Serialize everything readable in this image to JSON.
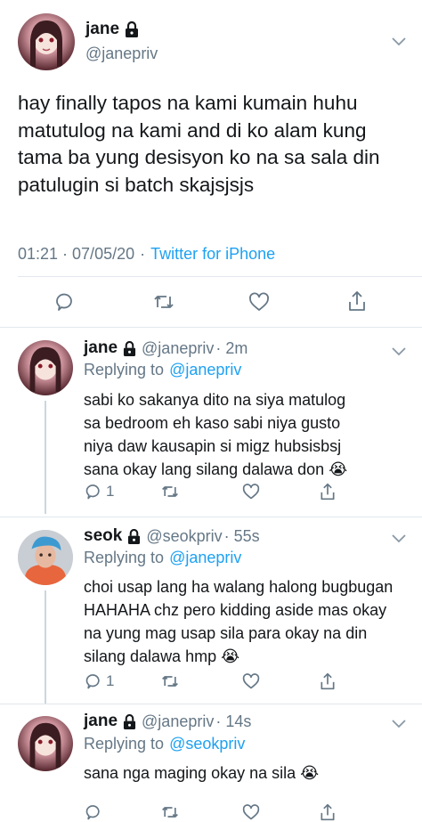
{
  "main": {
    "user_name": "jane",
    "handle": "@janepriv",
    "text": "hay finally tapos na kami kumain huhu matutulog na kami and di ko alam kung tama ba yung desisyon ko na sa sala din patulugin si batch skajsjsjs",
    "time": "01:21 · 07/05/20",
    "sep": "·",
    "source": "Twitter for iPhone"
  },
  "replies": [
    {
      "user_name": "jane",
      "handle": "@janepriv",
      "age": "· 2m",
      "replying_label": "Replying to",
      "replying_to": "@janepriv",
      "text": "sabi ko sakanya dito na siya matulog sa bedroom eh kaso sabi niya gusto niya daw kausapin si migz hubsisbsj sana okay lang silang dalawa don 😭",
      "reply_count": "1"
    },
    {
      "user_name": "seok",
      "handle": "@seokpriv",
      "age": "· 55s",
      "replying_label": "Replying to",
      "replying_to": "@janepriv",
      "text": "choi usap lang ha walang halong bugbugan HAHAHA chz pero kidding aside mas okay na yung mag usap sila para okay na din silang dalawa hmp 😭",
      "reply_count": "1"
    },
    {
      "user_name": "jane",
      "handle": "@janepriv",
      "age": "· 14s",
      "replying_label": "Replying to",
      "replying_to": "@seokpriv",
      "text": "sana nga maging okay na sila 😭",
      "reply_count": ""
    }
  ],
  "icons": [
    "lock-icon",
    "chevron-down-icon",
    "reply-icon",
    "retweet-icon",
    "like-icon",
    "share-icon"
  ],
  "colors": {
    "accent": "#1da1f2",
    "secondary": "#657786",
    "text": "#14171a",
    "divider": "#e1e8ed"
  }
}
